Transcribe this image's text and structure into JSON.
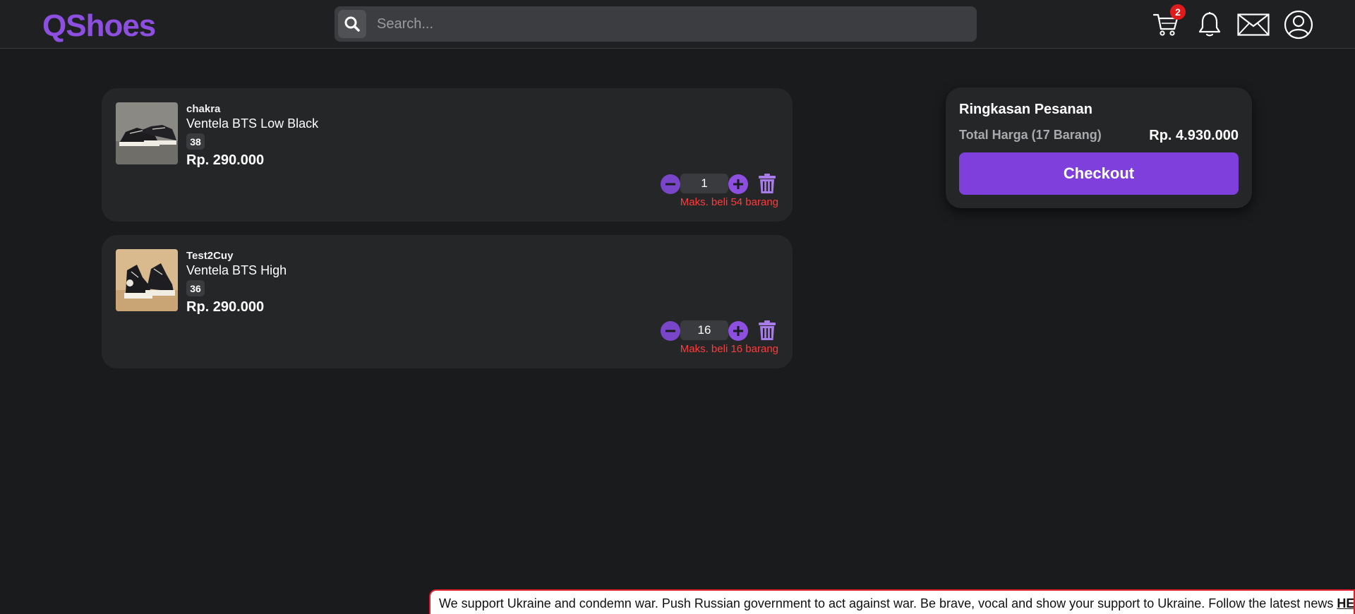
{
  "header": {
    "logo": "QShoes",
    "search": {
      "placeholder": "Search...",
      "value": ""
    },
    "cart_count": "2",
    "icons": [
      "search-icon",
      "cart-icon",
      "bell-icon",
      "mail-icon",
      "user-icon"
    ]
  },
  "cart": {
    "items": [
      {
        "store": "chakra",
        "name": "Ventela BTS Low Black",
        "size": "38",
        "price": "Rp. 290.000",
        "quantity": "1",
        "max_note": "Maks. beli 54 barang"
      },
      {
        "store": "Test2Cuy",
        "name": "Ventela BTS High",
        "size": "36",
        "price": "Rp. 290.000",
        "quantity": "16",
        "max_note": "Maks. beli 16 barang"
      }
    ]
  },
  "summary": {
    "title": "Ringkasan Pesanan",
    "total_label": "Total Harga (17 Barang)",
    "total_value": "Rp. 4.930.000",
    "checkout_label": "Checkout"
  },
  "banner": {
    "text": "We support Ukraine and condemn war. Push Russian government to act against war. Be brave, vocal and show your support to Ukraine. Follow the latest news ",
    "link": "HERE"
  },
  "colors": {
    "accent": "#8c4fe0",
    "background": "#1a1b1d",
    "card": "#252628",
    "error": "#ff3b3b",
    "badge": "#e01b1b"
  }
}
